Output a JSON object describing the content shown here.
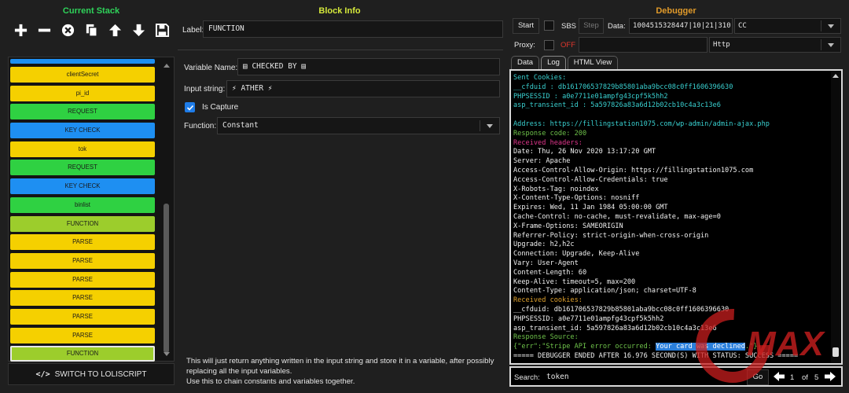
{
  "stack": {
    "title": "Current Stack",
    "toolbar": [
      {
        "name": "add-block-button",
        "icon": "plus-icon"
      },
      {
        "name": "remove-block-button",
        "icon": "minus-icon"
      },
      {
        "name": "clear-blocks-button",
        "icon": "clear-icon"
      },
      {
        "name": "clone-block-button",
        "icon": "clone-icon"
      },
      {
        "name": "move-up-button",
        "icon": "arrow-up-icon"
      },
      {
        "name": "move-down-button",
        "icon": "arrow-down-icon"
      },
      {
        "name": "save-config-button",
        "icon": "save-icon"
      }
    ],
    "items": [
      {
        "label": "",
        "color": "#1e8ff2"
      },
      {
        "label": "clientSecret",
        "color": "#f5d000"
      },
      {
        "label": "pi_id",
        "color": "#f5d000"
      },
      {
        "label": "REQUEST",
        "color": "#2fd142"
      },
      {
        "label": "KEY CHECK",
        "color": "#1e8ff2"
      },
      {
        "label": "tok",
        "color": "#f5d000"
      },
      {
        "label": "REQUEST",
        "color": "#2fd142"
      },
      {
        "label": "KEY CHECK",
        "color": "#1e8ff2"
      },
      {
        "label": "binlist",
        "color": "#2fd142"
      },
      {
        "label": "FUNCTION",
        "color": "#9ccd2c"
      },
      {
        "label": "PARSE",
        "color": "#f5d000"
      },
      {
        "label": "PARSE",
        "color": "#f5d000"
      },
      {
        "label": "PARSE",
        "color": "#f5d000"
      },
      {
        "label": "PARSE",
        "color": "#f5d000"
      },
      {
        "label": "PARSE",
        "color": "#f5d000"
      },
      {
        "label": "PARSE",
        "color": "#f5d000"
      },
      {
        "label": "FUNCTION",
        "color": "#9ccd2c",
        "selected": true
      }
    ],
    "switch_label": "SWITCH TO LOLISCRIPT"
  },
  "block": {
    "title": "Block Info",
    "label_caption": "Label:",
    "label_value": "FUNCTION",
    "variable_caption": "Variable Name:",
    "variable_value": "▤ CHECKED BY ▤",
    "input_caption": "Input string:",
    "input_value": "⚡ ATHER ⚡",
    "capture_caption": "Is Capture",
    "capture_checked": true,
    "function_caption": "Function:",
    "function_value": "Constant",
    "description": [
      "This will just return anything written in the input string and store it in a variable, after possibly",
      "replacing all the input variables.",
      "Use this to chain constants and variables together."
    ]
  },
  "debugger": {
    "title": "Debugger",
    "start_label": "Start",
    "sbs_label": "SBS",
    "step_label": "Step",
    "data_caption": "Data:",
    "data_value": "1004515328447|10|21|310",
    "type_value": "CC",
    "proxy_caption": "Proxy:",
    "proxy_state": "OFF",
    "proxy_value": "",
    "proxy_type_value": "Http",
    "tabs": [
      "Data",
      "Log",
      "HTML View"
    ],
    "active_tab": "Log",
    "colors": {
      "teal": "#39d0d0",
      "green": "#6ec24a",
      "pink": "#e0368c",
      "orange": "#e0a22e",
      "white": "#f0f0f0"
    },
    "log": [
      {
        "text": "Sent Cookies:",
        "color": "#39d0d0"
      },
      {
        "text": "__cfduid : db161706537829b85801aba9bcc08c0ff1606396630",
        "color": "#39d0d0"
      },
      {
        "text": "PHPSESSID : a0e7711e01ampfg43cpf5k5hh2",
        "color": "#39d0d0"
      },
      {
        "text": "asp_transient_id : 5a597826a83a6d12b02cb10c4a3c13e6",
        "color": "#39d0d0"
      },
      {
        "text": "",
        "color": "#39d0d0"
      },
      {
        "text": "Address: https://fillingstation1075.com/wp-admin/admin-ajax.php",
        "color": "#39d0d0"
      },
      {
        "text": "Response code: 200",
        "color": "#6ec24a"
      },
      {
        "text": "Received headers:",
        "color": "#e0368c"
      },
      {
        "text": "Date: Thu, 26 Nov 2020 13:17:20 GMT",
        "color": "#f0f0f0"
      },
      {
        "text": "Server: Apache",
        "color": "#f0f0f0"
      },
      {
        "text": "Access-Control-Allow-Origin: https://fillingstation1075.com",
        "color": "#f0f0f0"
      },
      {
        "text": "Access-Control-Allow-Credentials: true",
        "color": "#f0f0f0"
      },
      {
        "text": "X-Robots-Tag: noindex",
        "color": "#f0f0f0"
      },
      {
        "text": "X-Content-Type-Options: nosniff",
        "color": "#f0f0f0"
      },
      {
        "text": "Expires: Wed, 11 Jan 1984 05:00:00 GMT",
        "color": "#f0f0f0"
      },
      {
        "text": "Cache-Control: no-cache, must-revalidate, max-age=0",
        "color": "#f0f0f0"
      },
      {
        "text": "X-Frame-Options: SAMEORIGIN",
        "color": "#f0f0f0"
      },
      {
        "text": "Referrer-Policy: strict-origin-when-cross-origin",
        "color": "#f0f0f0"
      },
      {
        "text": "Upgrade: h2,h2c",
        "color": "#f0f0f0"
      },
      {
        "text": "Connection: Upgrade, Keep-Alive",
        "color": "#f0f0f0"
      },
      {
        "text": "Vary: User-Agent",
        "color": "#f0f0f0"
      },
      {
        "text": "Content-Length: 60",
        "color": "#f0f0f0"
      },
      {
        "text": "Keep-Alive: timeout=5, max=200",
        "color": "#f0f0f0"
      },
      {
        "text": "Content-Type: application/json; charset=UTF-8",
        "color": "#f0f0f0"
      },
      {
        "text": "Received cookies:",
        "color": "#e0a22e"
      },
      {
        "text": "__cfduid: db161706537829b85801aba9bcc08c0ff1606396630",
        "color": "#f0f0f0"
      },
      {
        "text": "PHPSESSID: a0e7711e01ampfg43cpf5k5hh2",
        "color": "#f0f0f0"
      },
      {
        "text": "asp_transient_id: 5a597826a83a6d12b02cb10c4a3c13e6",
        "color": "#f0f0f0"
      },
      {
        "text": "Response Source:",
        "color": "#6ec24a"
      },
      {
        "pre": "{\"err\":\"Stripe API error occurred: ",
        "highlight": "Your card was declined",
        "post": ".\"}",
        "color": "#6ec24a"
      },
      {
        "text": "===== DEBUGGER ENDED AFTER 16.976 SECOND(S) WITH STATUS: SUCCESS =====",
        "color": "#f0f0f0"
      }
    ],
    "search_caption": "Search:",
    "search_value": "token",
    "go_label": "Go",
    "match_current": "1",
    "match_of": "of",
    "match_total": "5"
  },
  "watermark": {
    "text": "MAX"
  }
}
